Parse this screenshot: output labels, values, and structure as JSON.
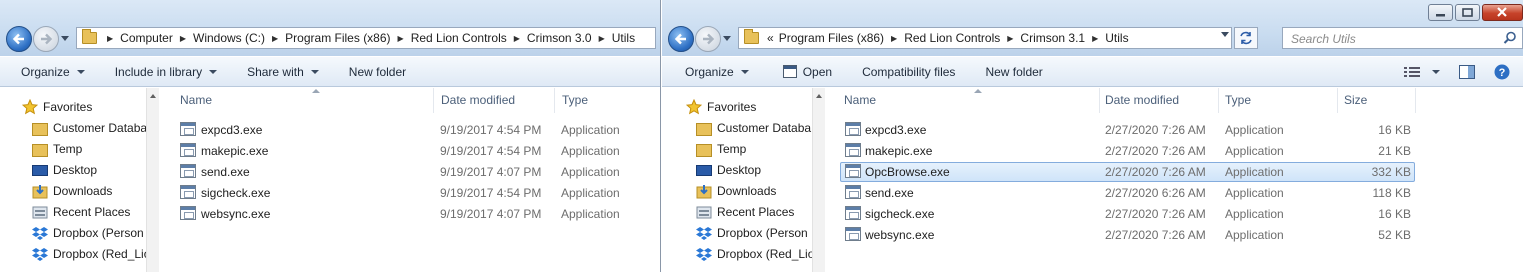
{
  "left": {
    "address": [
      "Computer",
      "Windows (C:)",
      "Program Files (x86)",
      "Red Lion Controls",
      "Crimson 3.0",
      "Utils"
    ],
    "toolbar": {
      "organize": "Organize",
      "include": "Include in library",
      "share": "Share with",
      "new_folder": "New folder"
    },
    "nav": [
      "Favorites",
      "Customer Databa",
      "Temp",
      "Desktop",
      "Downloads",
      "Recent Places",
      "Dropbox (Person",
      "Dropbox (Red_Lio"
    ],
    "columns": {
      "name": "Name",
      "date": "Date modified",
      "type": "Type"
    },
    "files": [
      {
        "name": "expcd3.exe",
        "date": "9/19/2017 4:54 PM",
        "type": "Application"
      },
      {
        "name": "makepic.exe",
        "date": "9/19/2017 4:54 PM",
        "type": "Application"
      },
      {
        "name": "send.exe",
        "date": "9/19/2017 4:07 PM",
        "type": "Application"
      },
      {
        "name": "sigcheck.exe",
        "date": "9/19/2017 4:54 PM",
        "type": "Application"
      },
      {
        "name": "websync.exe",
        "date": "9/19/2017 4:07 PM",
        "type": "Application"
      }
    ]
  },
  "right": {
    "overflow": "«",
    "address": [
      "Program Files (x86)",
      "Red Lion Controls",
      "Crimson 3.1",
      "Utils"
    ],
    "search_placeholder": "Search Utils",
    "toolbar": {
      "organize": "Organize",
      "open": "Open",
      "compat": "Compatibility files",
      "new_folder": "New folder"
    },
    "nav": [
      "Favorites",
      "Customer Databa",
      "Temp",
      "Desktop",
      "Downloads",
      "Recent Places",
      "Dropbox (Person",
      "Dropbox (Red_Lio"
    ],
    "columns": {
      "name": "Name",
      "date": "Date modified",
      "type": "Type",
      "size": "Size"
    },
    "files": [
      {
        "name": "expcd3.exe",
        "date": "2/27/2020 7:26 AM",
        "type": "Application",
        "size": "16 KB"
      },
      {
        "name": "makepic.exe",
        "date": "2/27/2020 7:26 AM",
        "type": "Application",
        "size": "21 KB"
      },
      {
        "name": "OpcBrowse.exe",
        "date": "2/27/2020 7:26 AM",
        "type": "Application",
        "size": "332 KB"
      },
      {
        "name": "send.exe",
        "date": "2/27/2020 6:26 AM",
        "type": "Application",
        "size": "118 KB"
      },
      {
        "name": "sigcheck.exe",
        "date": "2/27/2020 7:26 AM",
        "type": "Application",
        "size": "16 KB"
      },
      {
        "name": "websync.exe",
        "date": "2/27/2020 7:26 AM",
        "type": "Application",
        "size": "52 KB"
      }
    ],
    "selected_file": "OpcBrowse.exe"
  }
}
